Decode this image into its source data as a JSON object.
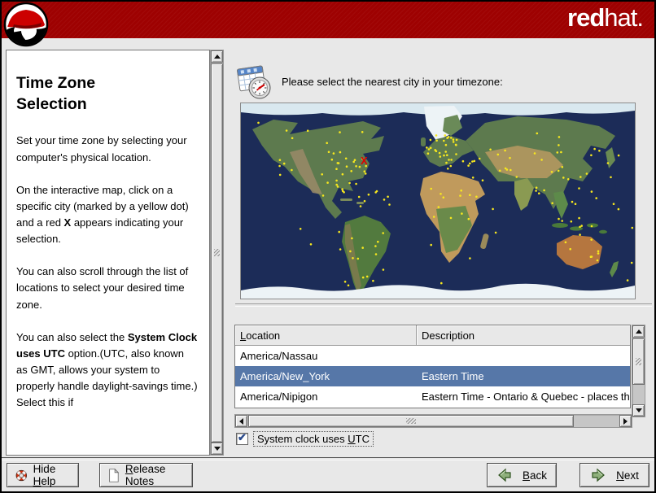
{
  "header": {
    "brand_red": "red",
    "brand_hat": "hat."
  },
  "help": {
    "title": "Time Zone Selection",
    "p1": "Set your time zone by selecting your computer's physical location.",
    "p2_pre": "On the interactive map, click on a specific city (marked by a yellow dot) and a red ",
    "p2_bold": "X",
    "p2_post": " appears indicating your selection.",
    "p3": "You can also scroll through the list of locations to select your desired time zone.",
    "p4_pre": "You can also select the ",
    "p4_bold": "System Clock uses UTC",
    "p4_post": " option.(UTC, also known as GMT, allows your system to properly handle daylight-savings time.) Select this if"
  },
  "main": {
    "prompt": "Please select the nearest city in your timezone:",
    "table": {
      "col_location_key": "L",
      "col_location_rest": "ocation",
      "col_description": "Description",
      "rows": [
        {
          "location": "America/Nassau",
          "description": ""
        },
        {
          "location": "America/New_York",
          "description": "Eastern Time"
        },
        {
          "location": "America/Nipigon",
          "description": "Eastern Time - Ontario & Quebec - places th"
        }
      ],
      "selected_index": 1
    },
    "utc": {
      "pre": "System clock uses ",
      "key": "U",
      "rest": "TC",
      "checked": true
    },
    "map_marker": "X"
  },
  "footer": {
    "hide_help_pre": "Hide ",
    "hide_help_key": "H",
    "hide_help_rest": "elp",
    "release_key": "R",
    "release_rest": "elease Notes",
    "back_key": "B",
    "back_rest": "ack",
    "next_key": "N",
    "next_rest": "ext"
  },
  "colors": {
    "header_red": "#9e0101",
    "selection_blue": "#5677a8",
    "dot_yellow": "#f7e81e",
    "marker_red": "#e00000"
  }
}
